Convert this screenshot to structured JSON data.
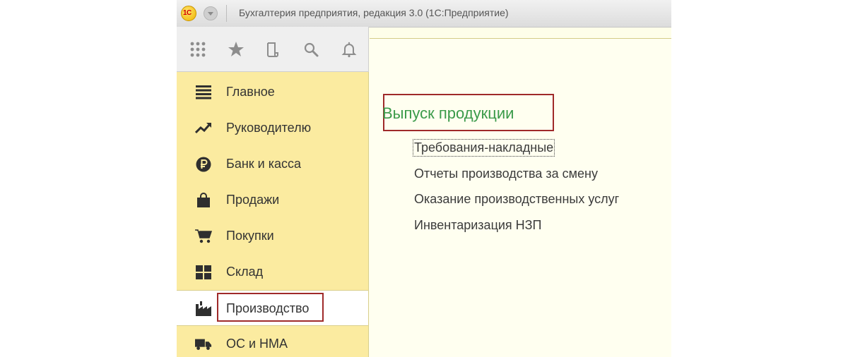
{
  "window": {
    "title": "Бухгалтерия предприятия, редакция 3.0  (1С:Предприятие)",
    "logo_text": "1С"
  },
  "toolbar": {
    "icons": [
      "apps-grid-icon",
      "star-icon",
      "history-icon",
      "search-icon",
      "bell-icon"
    ]
  },
  "sidebar": {
    "items": [
      {
        "label": "Главное",
        "icon": "list-icon"
      },
      {
        "label": "Руководителю",
        "icon": "trend-icon"
      },
      {
        "label": "Банк и касса",
        "icon": "ruble-icon"
      },
      {
        "label": "Продажи",
        "icon": "shopping-bag-icon"
      },
      {
        "label": "Покупки",
        "icon": "cart-icon"
      },
      {
        "label": "Склад",
        "icon": "warehouse-icon"
      },
      {
        "label": "Производство",
        "icon": "factory-icon",
        "active": true
      },
      {
        "label": "ОС и НМА",
        "icon": "truck-icon"
      }
    ]
  },
  "content": {
    "section_title": "Выпуск продукции",
    "links": [
      "Требования-накладные",
      "Отчеты производства за смену",
      "Оказание производственных услуг",
      "Инвентаризация НЗП"
    ]
  },
  "colors": {
    "sidebar_bg": "#fbeba0",
    "content_bg": "#fffff0",
    "section_title": "#3a9a4a",
    "highlight_border": "#9f2a2a"
  }
}
